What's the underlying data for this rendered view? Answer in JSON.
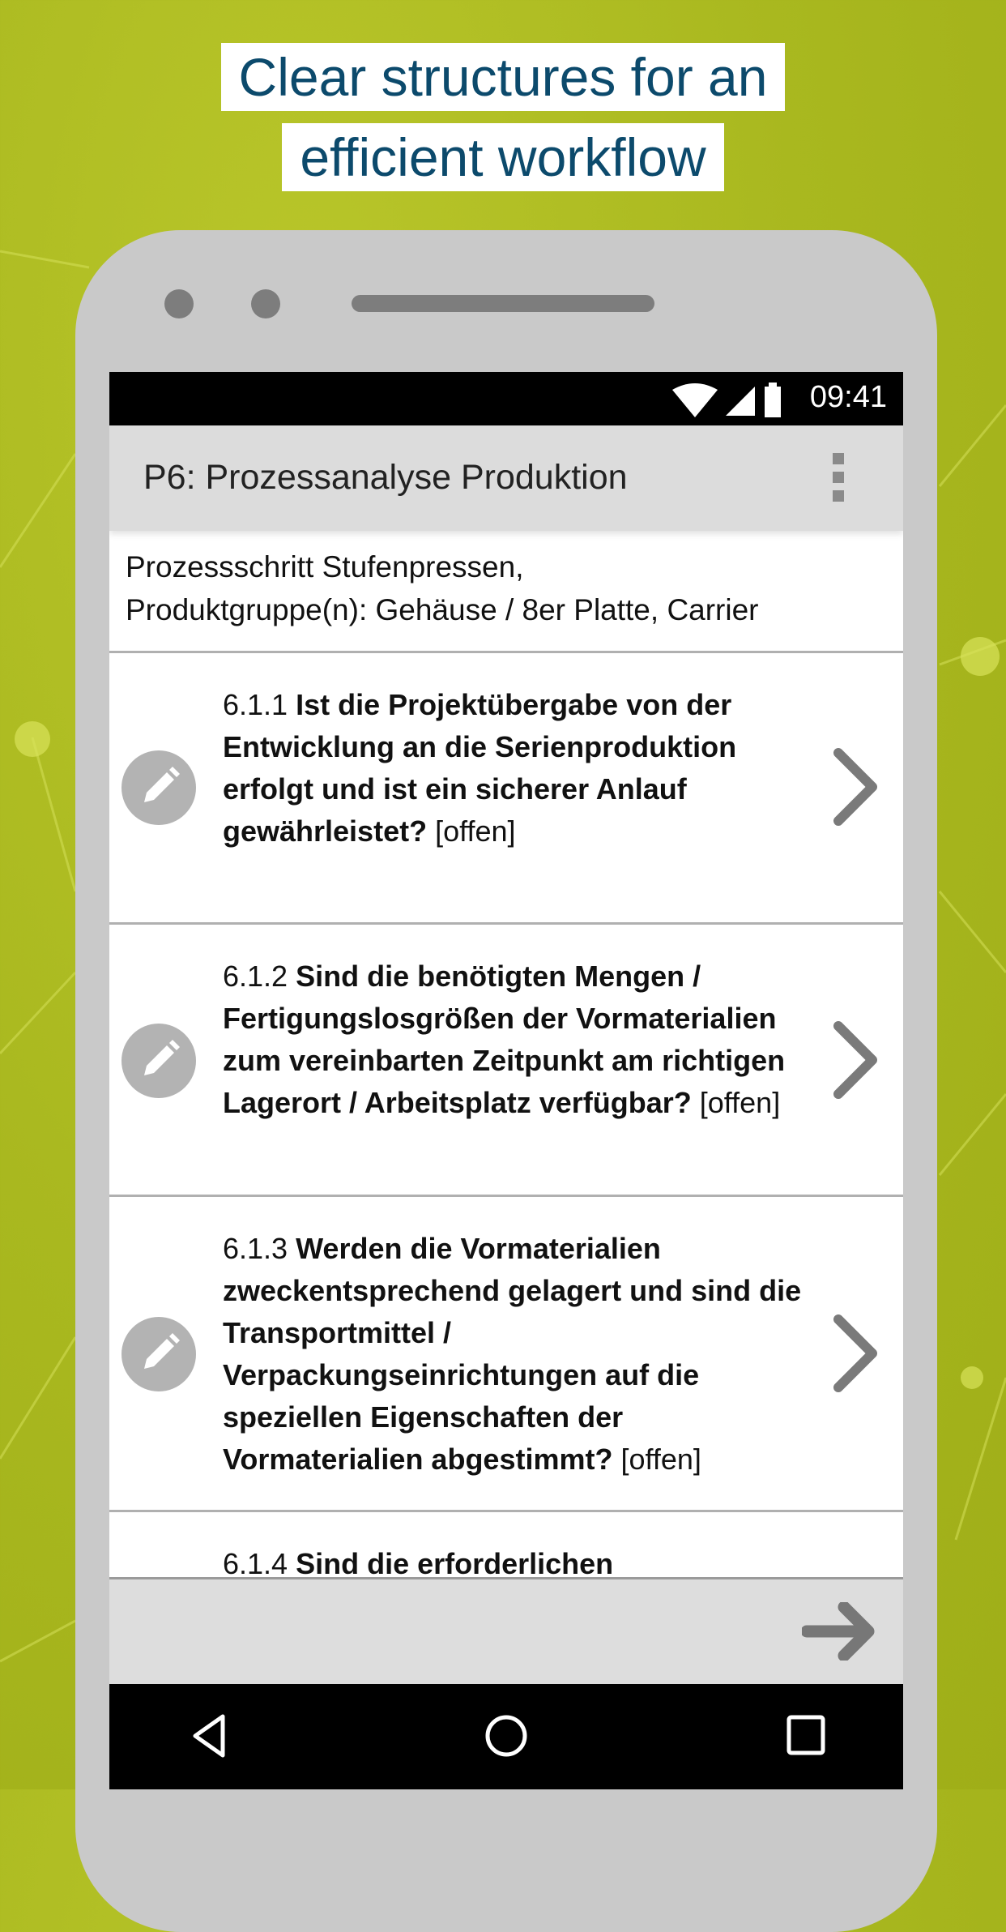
{
  "headline": {
    "line1": "Clear structures for an",
    "line2": "efficient workflow"
  },
  "colors": {
    "background": "#a9b81f",
    "headline_text": "#0c4a6c",
    "phone_body": "#c9c9c9",
    "appbar": "#dcdcdc"
  },
  "status_bar": {
    "time": "09:41",
    "icons": [
      "wifi-icon",
      "signal-icon",
      "battery-icon"
    ]
  },
  "app_bar": {
    "title": "P6: Prozessanalyse Produktion",
    "menu_icon": "more-vert-icon"
  },
  "subtitle": {
    "line1": "Prozessschritt Stufenpressen,",
    "line2": "Produktgruppe(n): Gehäuse / 8er Platte, Carrier"
  },
  "items": [
    {
      "number": "6.1.1",
      "question": "Ist die Projektübergabe von der Entwicklung an die Serienproduktion erfolgt und ist ein sicherer Anlauf gewährleistet?",
      "status": "[offen]"
    },
    {
      "number": "6.1.2",
      "question": "Sind die benötigten Mengen / Fertigungslosgrößen der Vormaterialien zum vereinbarten Zeitpunkt am richtigen Lagerort / Arbeitsplatz verfügbar?",
      "status": "[offen]"
    },
    {
      "number": "6.1.3",
      "question": "Werden die Vormaterialien zweckentsprechend gelagert und sind die Transportmittel / Verpackungseinrichtungen auf die speziellen Eigenschaften der Vormaterialien abgestimmt?",
      "status": "[offen]"
    },
    {
      "number": "6.1.4",
      "question": "Sind die erforderlichen",
      "status": ""
    }
  ],
  "bottom_bar": {
    "next_icon": "arrow-right-icon"
  },
  "nav_bar": {
    "icons": [
      "back-icon",
      "home-icon",
      "recents-icon"
    ]
  }
}
